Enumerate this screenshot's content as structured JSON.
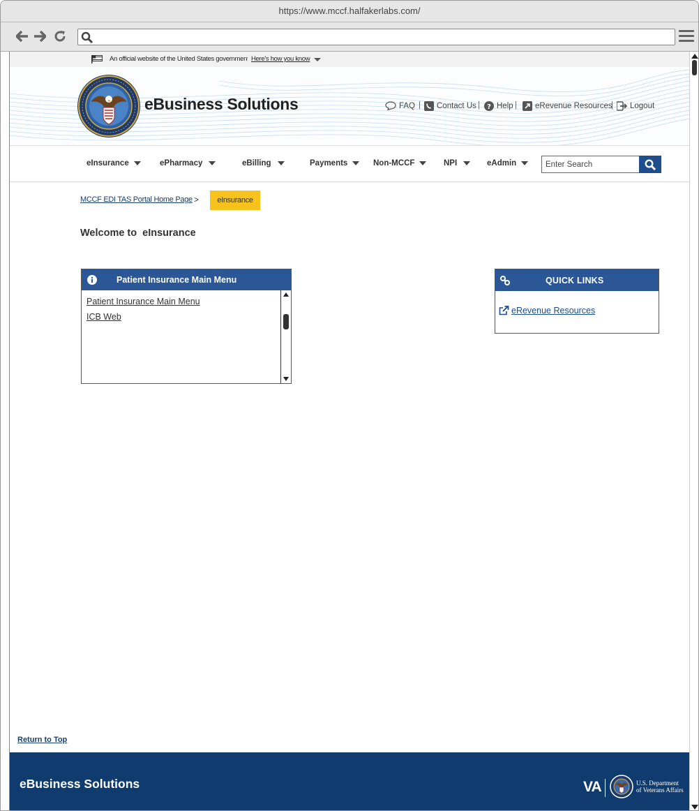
{
  "browser": {
    "url": "https://www.mccf.halfakerlabs.com/",
    "address_value": ""
  },
  "gov_banner": {
    "text": "An official website of the United States government",
    "link": "Here's how you know"
  },
  "header": {
    "site_title": "eBusiness Solutions",
    "utility_links": {
      "faq": "FAQ",
      "contact": "Contact Us",
      "help": "Help",
      "erevenue": "eRevenue Resources",
      "logout": "Logout"
    },
    "separator": "|"
  },
  "nav": {
    "items": [
      "eInsurance",
      "ePharmacy",
      "eBilling",
      "Payments",
      "Non-MCCF",
      "NPI",
      "eAdmin"
    ],
    "search_placeholder": "Enter Search"
  },
  "breadcrumb": {
    "home": "MCCF EDI TAS Portal Home Page",
    "separator": ">",
    "current": "eInsurance"
  },
  "welcome": "Welcome to  eInsurance",
  "patient_panel": {
    "title": "Patient Insurance Main Menu",
    "links": [
      "Patient Insurance Main Menu",
      "ICB Web"
    ]
  },
  "quick_links": {
    "title": "QUICK LINKS",
    "items": [
      "eRevenue Resources"
    ]
  },
  "return_to_top": "Return to Top",
  "footer": {
    "brand": "eBusiness Solutions",
    "va_mark": "VA",
    "dept_line1": "U.S. Department",
    "dept_line2": "of Veterans Affairs"
  },
  "colors": {
    "primary_blue": "#2b5797",
    "footer_blue": "#0f3b6e",
    "breadcrumb_highlight": "#f6c21b",
    "search_button": "#1f4e8c"
  },
  "icons": {
    "back": "arrow-left-icon",
    "forward": "arrow-right-icon",
    "reload": "reload-icon",
    "search": "search-icon",
    "menu": "hamburger-menu-icon",
    "flag": "us-flag-icon",
    "faq": "speech-bubble-icon",
    "contact": "phone-icon",
    "help": "question-circle-icon",
    "erevenue": "external-link-icon",
    "logout": "logout-icon",
    "info": "info-circle-icon",
    "quick_links": "link-icon"
  }
}
